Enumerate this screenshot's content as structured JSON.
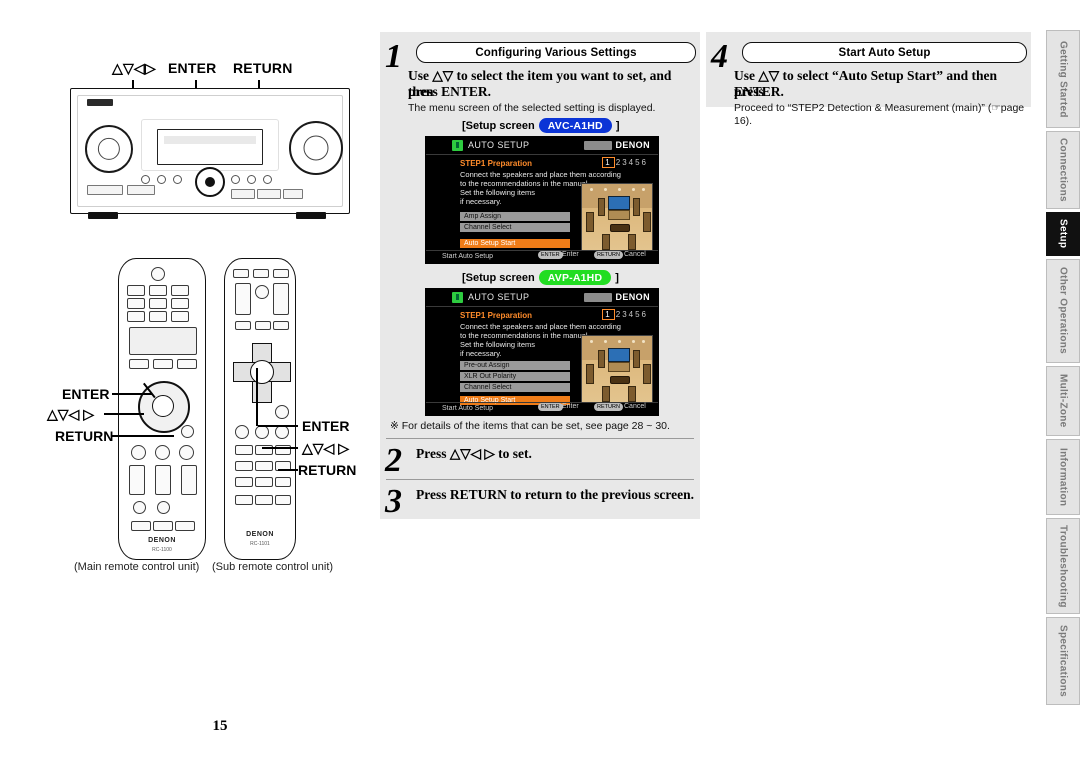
{
  "document": {
    "page_number": "15"
  },
  "left": {
    "top_callouts": {
      "arrows": "△▽◁▷",
      "enter": "ENTER",
      "return": "RETURN"
    },
    "main_remote_callouts": {
      "enter": "ENTER",
      "arrows": "△▽◁ ▷",
      "return": "RETURN"
    },
    "sub_remote_callouts": {
      "enter": "ENTER",
      "arrows": "△▽◁ ▷",
      "return": "RETURN"
    },
    "brand": "DENON",
    "main_remote_model": "RC-1100",
    "sub_remote_model": "RC-1101",
    "captions": {
      "main": "(Main remote control unit)",
      "sub": "(Sub remote control unit)"
    }
  },
  "steps": {
    "step1": {
      "number": "1",
      "banner": "Configuring Various Settings",
      "instruction_line1": "Use △▽ to select the item you want to set, and then",
      "instruction_line2": "press ENTER.",
      "note": "The menu screen of the selected setting is displayed."
    },
    "step2": {
      "number": "2",
      "instruction": "Press △▽◁ ▷ to set."
    },
    "step3": {
      "number": "3",
      "instruction": "Press RETURN to return to the previous screen."
    },
    "step4": {
      "number": "4",
      "banner": "Start Auto Setup",
      "instruction_line1": "Use △▽ to select “Auto Setup Start” and then press",
      "instruction_line2": "ENTER.",
      "note_line1": "Proceed to “STEP2 Detection & Measurement (main)” (☞page",
      "note_line2": "16)."
    }
  },
  "setup_screens": [
    {
      "label_prefix": "[Setup screen",
      "model_badge": "AVC-A1HD",
      "badge_color": "#0b34d6",
      "label_suffix": "]",
      "osd": {
        "header_title": "AUTO SETUP",
        "brand": "DENON",
        "audyssey_logo": "AUDYSSEY",
        "step_title": "STEP1 Preparation",
        "body_lines": [
          "Connect the speakers and place them according",
          "to the recommendations in the manual.",
          "Set the following items",
          "if necessary."
        ],
        "step_indicator": [
          "1",
          "2",
          "3",
          "4",
          "5",
          "6"
        ],
        "active_step": "1",
        "menu_items": [
          "Amp Assign",
          "Channel Select"
        ],
        "highlighted_item": "Auto Setup Start",
        "footer_status": "Start Auto Setup",
        "footer_enter_key": "ENTER",
        "footer_enter_label": "Enter",
        "footer_cancel_key": "RETURN",
        "footer_cancel_label": "Cancel"
      }
    },
    {
      "label_prefix": "[Setup screen",
      "model_badge": "AVP-A1HD",
      "badge_color": "#22dd22",
      "label_suffix": "]",
      "osd": {
        "header_title": "AUTO SETUP",
        "brand": "DENON",
        "audyssey_logo": "AUDYSSEY",
        "step_title": "STEP1 Preparation",
        "body_lines": [
          "Connect the speakers and place them according",
          "to the recommendations in the manual.",
          "Set the following items",
          "if necessary."
        ],
        "step_indicator": [
          "1",
          "2",
          "3",
          "4",
          "5",
          "6"
        ],
        "active_step": "1",
        "menu_items": [
          "Pre-out Assign",
          "XLR Out Polarity",
          "Channel Select"
        ],
        "highlighted_item": "Auto Setup Start",
        "footer_status": "Start Auto Setup",
        "footer_enter_key": "ENTER",
        "footer_enter_label": "Enter",
        "footer_cancel_key": "RETURN",
        "footer_cancel_label": "Cancel"
      }
    }
  ],
  "footnote": "※ For details of the items that can be set, see page 28 ~ 30.",
  "sidebar": {
    "tabs": [
      {
        "label": "Getting Started",
        "active": false
      },
      {
        "label": "Connections",
        "active": false
      },
      {
        "label": "Setup",
        "active": true
      },
      {
        "label": "Other Operations",
        "active": false
      },
      {
        "label": "Multi-Zone",
        "active": false
      },
      {
        "label": "Information",
        "active": false
      },
      {
        "label": "Troubleshooting",
        "active": false
      },
      {
        "label": "Specifications",
        "active": false
      }
    ]
  }
}
